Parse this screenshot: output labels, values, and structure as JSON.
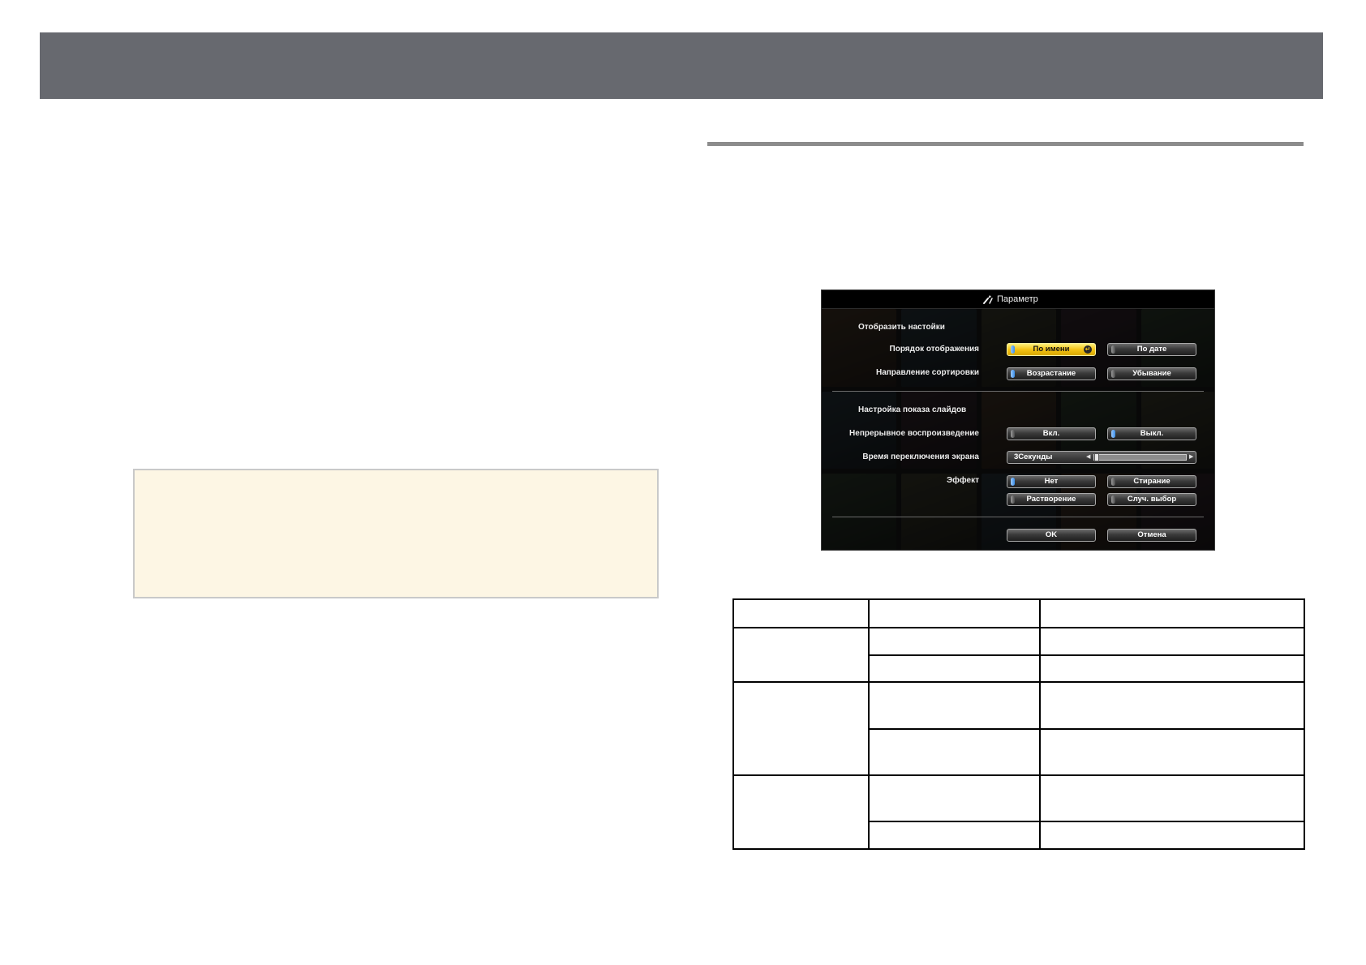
{
  "colors": {
    "header_bar": "#67696f",
    "divider": "#8c8c8c",
    "note_bg": "#fdf6e4",
    "note_border": "#c9c9c9",
    "table_border": "#000000",
    "dialog_bg": "#0d0d0d",
    "focus_highlight": "#f3c316",
    "indicator_on": "#3b8fe8"
  },
  "dialog": {
    "title": "Параметр",
    "title_icon": "settings-tools-icon",
    "section_display": "Отобразить настойки",
    "focused": "По имени",
    "sort_order": {
      "label": "Порядок отображения",
      "options": [
        "По имени",
        "По дате"
      ],
      "selected": "По имени"
    },
    "sort_direction": {
      "label": "Направление сортировки",
      "options": [
        "Возрастание",
        "Убывание"
      ],
      "selected": "Возрастание"
    },
    "section_slideshow": "Настройка показа слайдов",
    "continuous_play": {
      "label": "Непрерывное воспроизведение",
      "options": [
        "Вкл.",
        "Выкл."
      ],
      "selected": "Выкл."
    },
    "interval": {
      "label": "Время переключения экрана",
      "value": "3Секунды",
      "level": 0
    },
    "effect": {
      "label": "Эффект",
      "options": [
        "Нет",
        "Стирание",
        "Растворение",
        "Случ. выбор"
      ],
      "selected": "Нет"
    },
    "ok": "OK",
    "cancel": "Отмена"
  }
}
